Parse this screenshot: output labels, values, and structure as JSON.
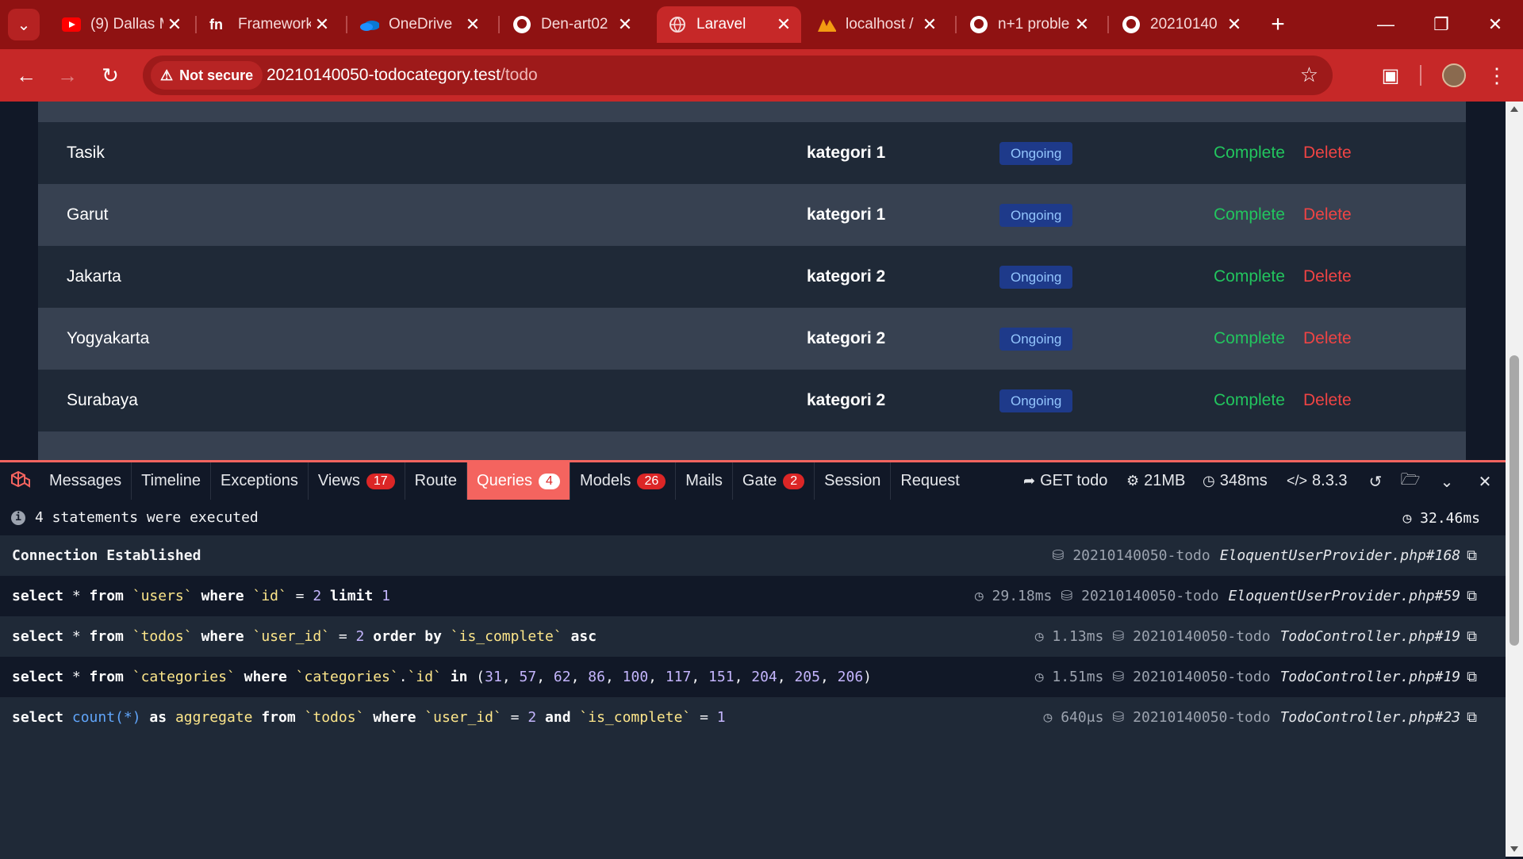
{
  "browser": {
    "tabs": [
      {
        "title": "(9) Dallas M",
        "icon": "youtube-icon"
      },
      {
        "title": "Framework",
        "icon": "framework-icon"
      },
      {
        "title": "OneDrive",
        "icon": "onedrive-icon"
      },
      {
        "title": "Den-art02",
        "icon": "github-icon"
      },
      {
        "title": "Laravel",
        "icon": "globe-icon",
        "active": true
      },
      {
        "title": "localhost /",
        "icon": "phpmyadmin-icon"
      },
      {
        "title": "n+1 proble",
        "icon": "github-icon"
      },
      {
        "title": "20210140",
        "icon": "github-icon"
      }
    ],
    "security_label": "Not secure",
    "url_host": "20210140050-todocategory.test",
    "url_path": "/todo"
  },
  "todos": [
    {
      "title": "Tasik",
      "category": "kategori 1",
      "status": "Ongoing",
      "complete": "Complete",
      "delete": "Delete"
    },
    {
      "title": "Garut",
      "category": "kategori 1",
      "status": "Ongoing",
      "complete": "Complete",
      "delete": "Delete"
    },
    {
      "title": "Jakarta",
      "category": "kategori 2",
      "status": "Ongoing",
      "complete": "Complete",
      "delete": "Delete"
    },
    {
      "title": "Yogyakarta",
      "category": "kategori 2",
      "status": "Ongoing",
      "complete": "Complete",
      "delete": "Delete"
    },
    {
      "title": "Surabaya",
      "category": "kategori 2",
      "status": "Ongoing",
      "complete": "Complete",
      "delete": "Delete"
    }
  ],
  "debugbar": {
    "tabs": [
      {
        "label": "Messages"
      },
      {
        "label": "Timeline"
      },
      {
        "label": "Exceptions"
      },
      {
        "label": "Views",
        "badge": "17"
      },
      {
        "label": "Route"
      },
      {
        "label": "Queries",
        "badge": "4",
        "active": true
      },
      {
        "label": "Models",
        "badge": "26"
      },
      {
        "label": "Mails"
      },
      {
        "label": "Gate",
        "badge": "2"
      },
      {
        "label": "Session"
      },
      {
        "label": "Request"
      }
    ],
    "request": "GET todo",
    "memory": "21MB",
    "duration": "348ms",
    "php_version": "8.3.3",
    "summary": "4 statements were executed",
    "total_time": "32.46ms",
    "connection": {
      "label": "Connection Established",
      "db": "20210140050-todo",
      "source": "EloquentUserProvider.php#168"
    },
    "queries": [
      {
        "sql": "select * from `users` where `id` = 2 limit 1",
        "time": "29.18ms",
        "db": "20210140050-todo",
        "source": "EloquentUserProvider.php#59"
      },
      {
        "sql": "select * from `todos` where `user_id` = 2 order by `is_complete` asc",
        "time": "1.13ms",
        "db": "20210140050-todo",
        "source": "TodoController.php#19"
      },
      {
        "sql": "select * from `categories` where `categories`.`id` in (31, 57, 62, 86, 100, 117, 151, 204, 205, 206)",
        "time": "1.51ms",
        "db": "20210140050-todo",
        "source": "TodoController.php#19"
      },
      {
        "sql": "select count(*) as aggregate from `todos` where `user_id` = 2 and `is_complete` = 1",
        "time": "640μs",
        "db": "20210140050-todo",
        "source": "TodoController.php#23"
      }
    ]
  }
}
